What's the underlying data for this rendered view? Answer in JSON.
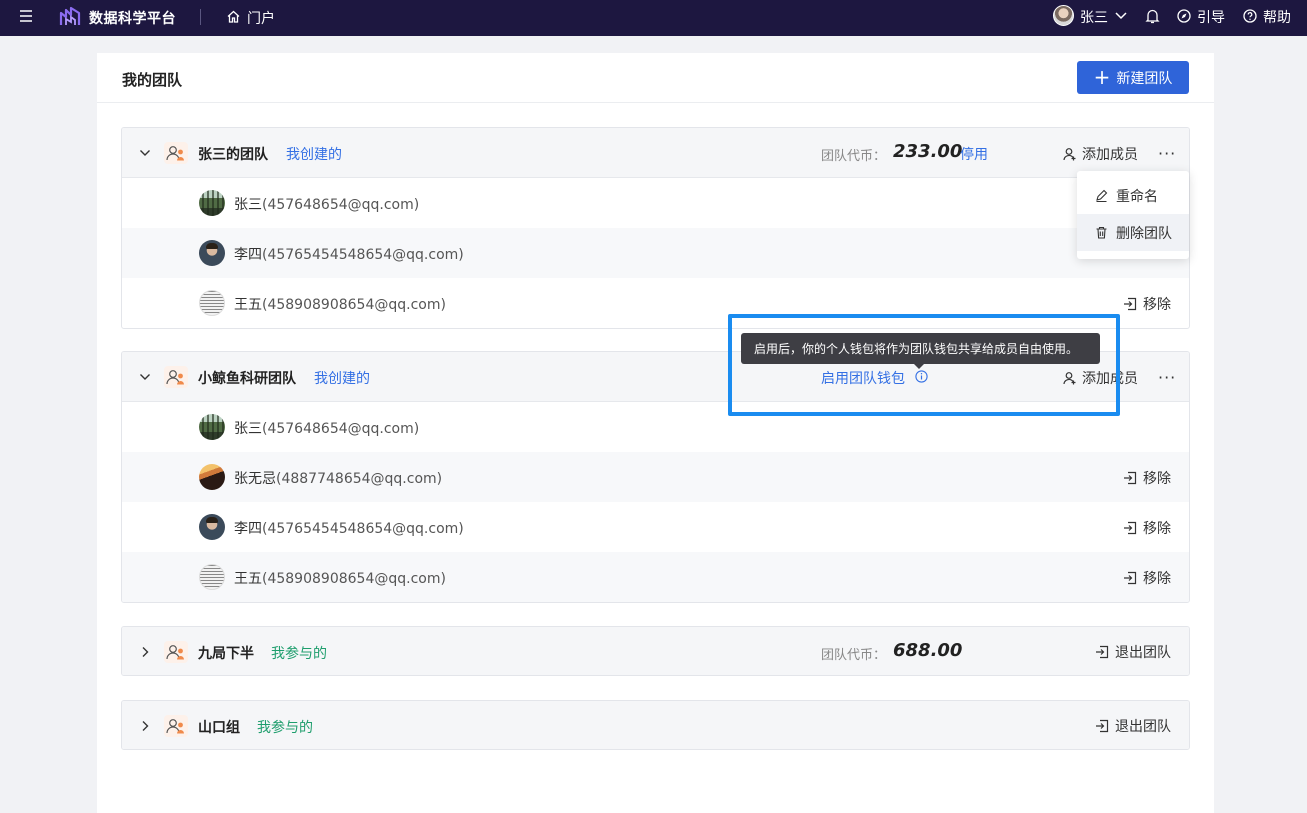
{
  "topbar": {
    "app_title": "数据科学平台",
    "portal": "门户",
    "user_name": "张三",
    "guide": "引导",
    "help": "帮助"
  },
  "page": {
    "title": "我的团队",
    "new_team_label": "新建团队"
  },
  "labels": {
    "coin_label": "团队代币：",
    "disable": "停用",
    "enable_wallet": "启用团队钱包",
    "add_member": "添加成员",
    "remove": "移除",
    "quit_team": "退出团队",
    "more": "···"
  },
  "dropdown": {
    "rename": "重命名",
    "delete_team": "删除团队"
  },
  "tooltip": {
    "text": "启用后，你的个人钱包将作为团队钱包共享给成员自由使用。"
  },
  "teams": [
    {
      "name": "张三的团队",
      "tag": "我创建的",
      "coins": "233.00",
      "members": [
        {
          "name": "张三",
          "email": "(457648654@qq.com)"
        },
        {
          "name": "李四",
          "email": "(45765454548654@qq.com)"
        },
        {
          "name": "王五",
          "email": "(458908908654@qq.com)"
        }
      ]
    },
    {
      "name": "小鲸鱼科研团队",
      "tag": "我创建的",
      "members": [
        {
          "name": "张三",
          "email": "(457648654@qq.com)"
        },
        {
          "name": "张无忌",
          "email": "(4887748654@qq.com)"
        },
        {
          "name": "李四",
          "email": "(45765454548654@qq.com)"
        },
        {
          "name": "王五",
          "email": "(458908908654@qq.com)"
        }
      ]
    },
    {
      "name": "九局下半",
      "tag": "我参与的",
      "coins": "688.00"
    },
    {
      "name": "山口组",
      "tag": "我参与的"
    }
  ],
  "colors": {
    "topbar": "#1d1740",
    "primary": "#2f64d9",
    "link": "#3470e4",
    "tag_joined": "#1e9e6d",
    "highlight": "#1a8cf0"
  },
  "icons": [
    "menu-icon",
    "logo-icon",
    "home-icon",
    "chevron-down-icon",
    "bell-icon",
    "guide-icon",
    "help-icon",
    "plus-icon",
    "team-icon",
    "user-add-icon",
    "more-icon",
    "info-icon",
    "logout-icon",
    "edit-icon",
    "trash-icon",
    "chevron-right-icon"
  ]
}
